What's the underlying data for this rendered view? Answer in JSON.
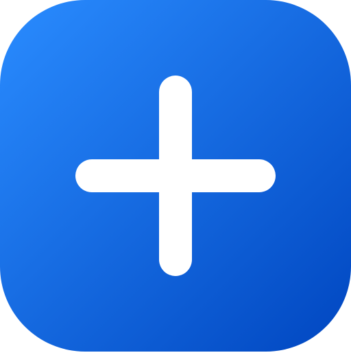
{
  "icon": {
    "name": "add-icon",
    "symbol": "plus",
    "colors": {
      "gradient_start": "#2a8cff",
      "gradient_end": "#0046c0",
      "glyph": "#ffffff"
    }
  }
}
